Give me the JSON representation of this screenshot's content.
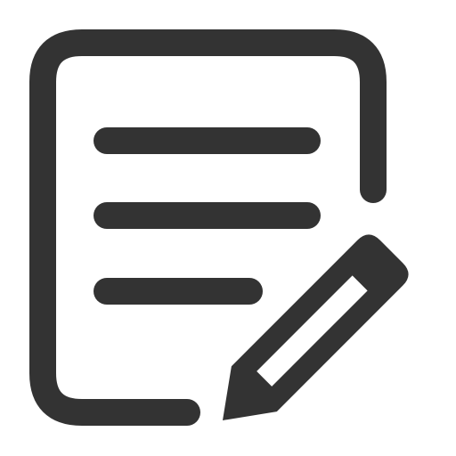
{
  "icon": {
    "name": "edit-document-icon",
    "stroke_color": "#333333",
    "background_color": "#ffffff",
    "parts": [
      "document-outline",
      "text-line",
      "text-line",
      "text-line-short",
      "pencil"
    ]
  }
}
